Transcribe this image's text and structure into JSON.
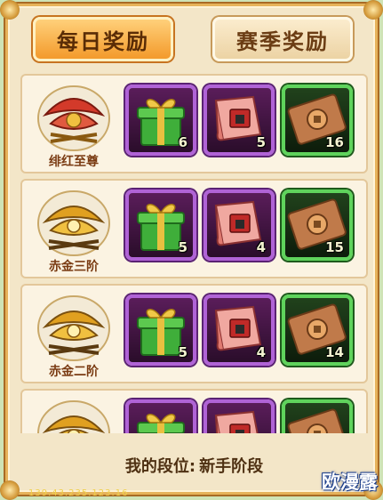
{
  "tabs": [
    {
      "label": "每日奖励",
      "active": true
    },
    {
      "label": "赛季奖励",
      "active": false
    }
  ],
  "rows": [
    {
      "rank": "绯红至尊",
      "crest": "red",
      "items": [
        {
          "icon": "gift-box",
          "qty": "6"
        },
        {
          "icon": "scroll",
          "qty": "5"
        },
        {
          "icon": "coin-ticket",
          "qty": "16"
        }
      ]
    },
    {
      "rank": "赤金三阶",
      "crest": "gold",
      "items": [
        {
          "icon": "gift-box",
          "qty": "5"
        },
        {
          "icon": "scroll",
          "qty": "4"
        },
        {
          "icon": "coin-ticket",
          "qty": "15"
        }
      ]
    },
    {
      "rank": "赤金二阶",
      "crest": "gold",
      "items": [
        {
          "icon": "gift-box",
          "qty": "5"
        },
        {
          "icon": "scroll",
          "qty": "4"
        },
        {
          "icon": "coin-ticket",
          "qty": "14"
        }
      ]
    },
    {
      "rank": "",
      "crest": "gold",
      "items": [
        {
          "icon": "gift-box",
          "qty": ""
        },
        {
          "icon": "scroll",
          "qty": ""
        },
        {
          "icon": "coin-ticket",
          "qty": ""
        }
      ]
    }
  ],
  "footer": {
    "label": "我的段位:",
    "value": "新手阶段"
  },
  "watermark": "欧漫露",
  "ip_text": "139.43.235.123.16",
  "colors": {
    "red_crest": "#d33a2a",
    "gold_crest": "#e0a020",
    "purple_frame": "#b063d6",
    "green_frame": "#5fd35c"
  }
}
